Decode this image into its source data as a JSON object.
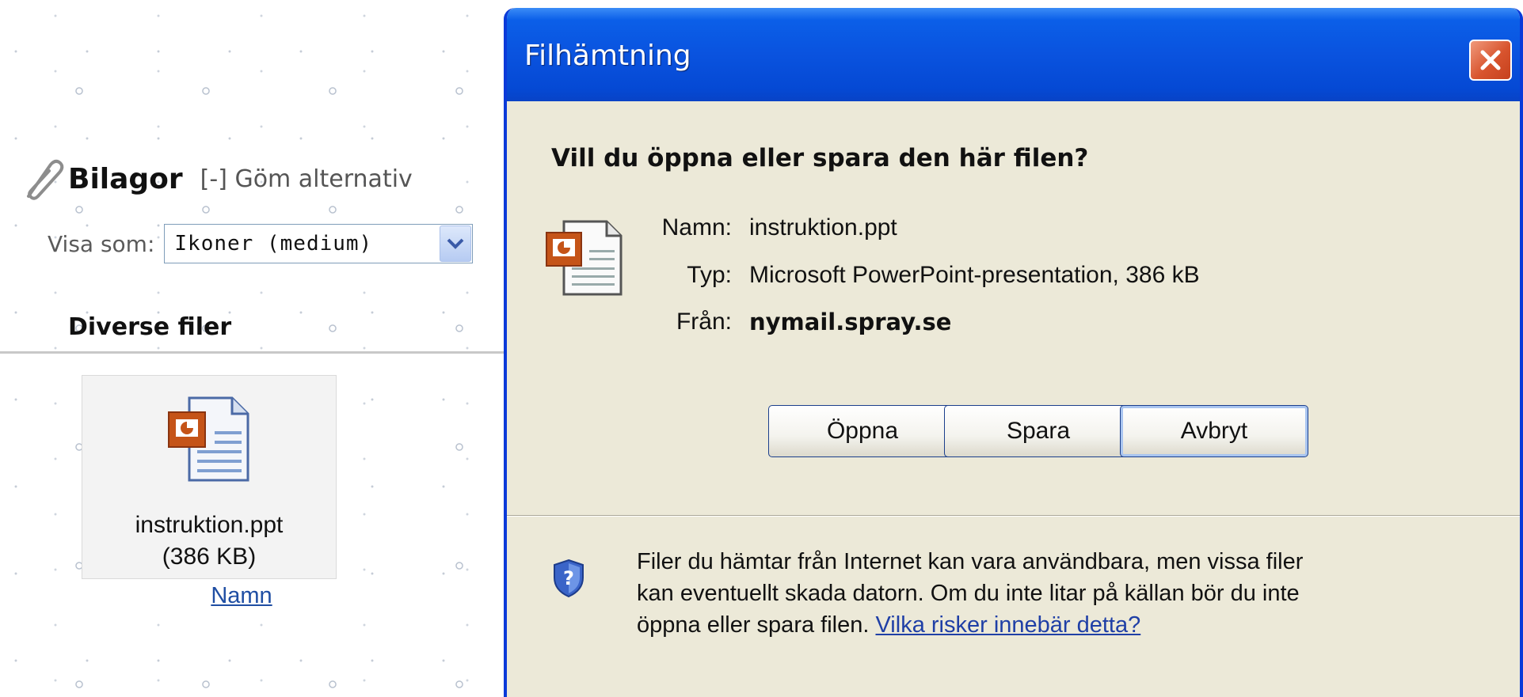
{
  "attachments": {
    "title": "Bilagor",
    "toggle": "[-] Göm alternativ",
    "view_label": "Visa som:",
    "view_value": "Ikoner (medium)",
    "category": "Diverse filer",
    "file": {
      "name": "instruktion.ppt",
      "size": "(386 KB)"
    },
    "sort_link": "Namn"
  },
  "dialog": {
    "title": "Filhämtning",
    "question": "Vill du öppna eller spara den här filen?",
    "fields": {
      "name_label": "Namn:",
      "name_value": "instruktion.ppt",
      "type_label": "Typ:",
      "type_value": "Microsoft PowerPoint-presentation, 386 kB",
      "from_label": "Från:",
      "from_value": "nymail.spray.se"
    },
    "buttons": {
      "open": "Öppna",
      "save": "Spara",
      "cancel": "Avbryt"
    },
    "warning_text": "Filer du hämtar från Internet kan vara användbara, men vissa filer kan eventuellt skada datorn. Om du inte litar på källan bör du inte öppna eller spara filen.",
    "risk_link": "Vilka risker innebär detta?"
  },
  "icons": {
    "attachment": "paperclip-icon",
    "dropdown": "chevron-down-icon",
    "file": "powerpoint-file-icon",
    "close": "close-icon",
    "security": "shield-help-icon"
  },
  "colors": {
    "titlebar": "#0a53df",
    "dialog_bg": "#ece9d8",
    "close_button": "#d8542e",
    "link": "#1f4ea3"
  }
}
